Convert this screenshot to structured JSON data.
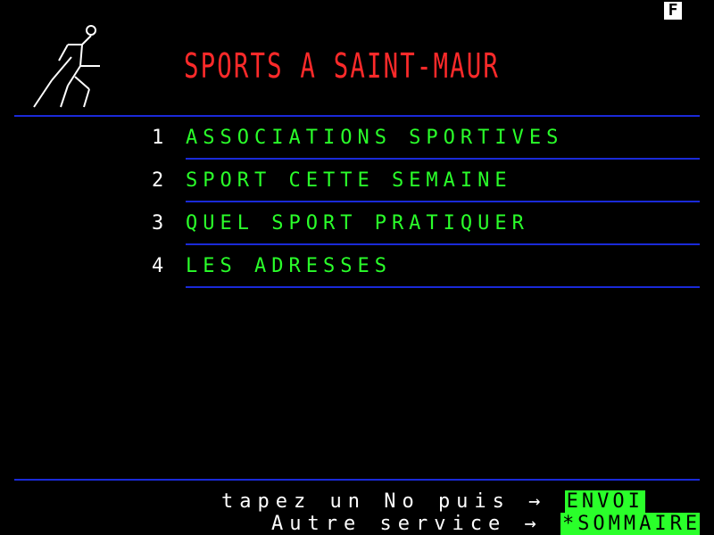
{
  "mode_indicator": "F",
  "title": "SPORTS A SAINT-MAUR",
  "colors": {
    "title": "#ff2a2a",
    "menu": "#2aff2a",
    "rule": "#1a2ad8",
    "key_bg": "#2aff2a"
  },
  "icon": "running-man-icon",
  "menu": [
    {
      "number": "1",
      "label": "ASSOCIATIONS SPORTIVES"
    },
    {
      "number": "2",
      "label": "SPORT CETTE SEMAINE"
    },
    {
      "number": "3",
      "label": "QUEL SPORT PRATIQUER"
    },
    {
      "number": "4",
      "label": "LES ADRESSES"
    }
  ],
  "footer": {
    "line1_text": "tapez un No puis",
    "line1_arrow": "→",
    "line1_key": "ENVOI",
    "line2_text": "Autre service",
    "line2_arrow": "→",
    "line2_key": "*SOMMAIRE"
  }
}
